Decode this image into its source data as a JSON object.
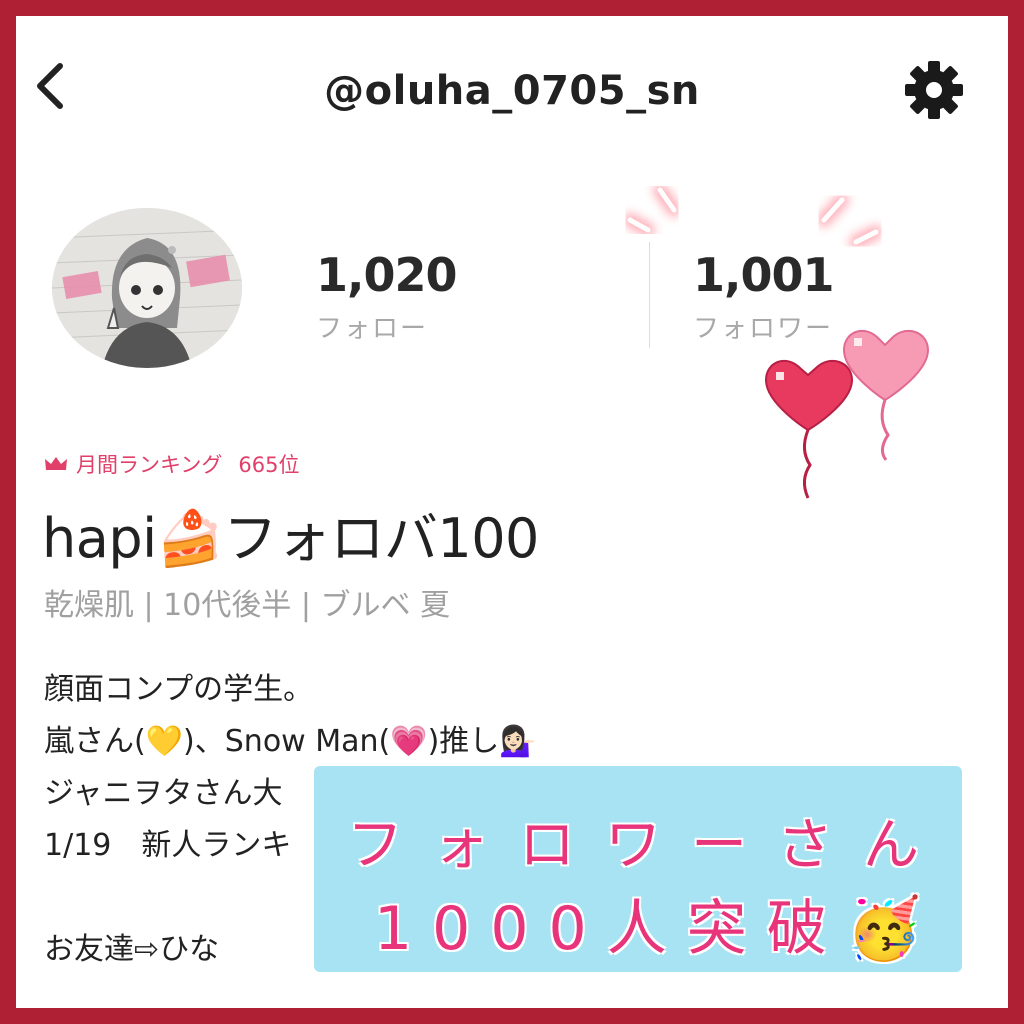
{
  "header": {
    "handle": "@oluha_0705_sn",
    "back_icon": "chevron-left-icon",
    "settings_icon": "gear-icon"
  },
  "profile": {
    "follow_count": "1,020",
    "follow_label": "フォロー",
    "follower_count": "1,001",
    "follower_label": "フォロワー",
    "ranking_label": "月間ランキング",
    "ranking_rank": "665位",
    "display_name": "hapi🍰フォロバ100",
    "tags": "乾燥肌 | 10代後半 | ブルベ 夏"
  },
  "bio": {
    "lines": [
      "顔面コンプの学生。",
      "嵐さん(💛)、Snow Man(💗)推し💁🏻‍♀️",
      "ジャニヲタさん大",
      "1/19　新人ランキ",
      "",
      "お友達⇨ひな"
    ]
  },
  "banner": {
    "line1": "フォロワーさん",
    "line2": "1000人突破🥳"
  },
  "colors": {
    "frame": "#b02034",
    "accent_pink": "#e0406a",
    "banner_bg": "#a8e3f3",
    "banner_text": "#e8347a"
  }
}
